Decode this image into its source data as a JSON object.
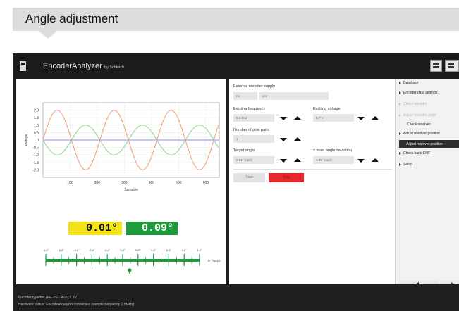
{
  "heading": "Angle adjustment",
  "app": {
    "title": "EncoderAnalyzer",
    "subtitle": "by Schleich"
  },
  "chart_data": {
    "type": "line",
    "xlabel": "Samples",
    "ylabel": "Voltage",
    "xlim": [
      0,
      650
    ],
    "ylim": [
      -2.5,
      2.5
    ],
    "x_ticks": [
      "100",
      "200",
      "300",
      "400",
      "500",
      "600"
    ],
    "y_ticks": [
      "2.0",
      "1.5",
      "1.0",
      "0.5",
      "0",
      "-0.5",
      "-1.0",
      "-1.5",
      "-2.0"
    ],
    "series": [
      {
        "color": "#f2a47a",
        "amplitude": 2.0,
        "period": 210,
        "phase_deg": 0
      },
      {
        "color": "#9ed49a",
        "amplitude": 1.0,
        "period": 210,
        "phase_deg": 180
      },
      {
        "color": "#8c8cff",
        "amplitude": 0.0,
        "period": 210,
        "phase_deg": 0
      }
    ]
  },
  "values": {
    "angle": "0.01°",
    "deviation": "0.09°",
    "yellow": "#f2e21a",
    "green": "#1f9a3c"
  },
  "scale": {
    "ticks": [
      "-1,0°",
      "-0,8°",
      "-0,6°",
      "-0,4°",
      "-0,2°",
      "0,0°",
      "0,2°",
      "0,4°",
      "0,6°",
      "0,8°",
      "1,0°"
    ],
    "unit": "in °mech",
    "indicator": 0.09
  },
  "form": {
    "supply_label": "External encoder supply",
    "supply_value1": "no",
    "supply_value2": "yes",
    "freq_label": "Exciting frequency",
    "freq_value": "5.0",
    "freq_unit": "kHz",
    "volt_label": "Exciting voltage",
    "volt_value": "5.7 V",
    "pole_label": "Number of pole pairs",
    "pole_value": "1",
    "target_label": "Target angle",
    "target_value": "0.01",
    "target_unit": "°mech",
    "dev_label": "± max. angle deviation",
    "dev_value": "1.00",
    "dev_unit": "°mech",
    "start_label": "Start",
    "stop_label": "Stop"
  },
  "sidebar": {
    "items": [
      {
        "label": "Database",
        "state": "normal"
      },
      {
        "label": "Encoder data settings",
        "state": "normal"
      },
      {
        "label": "Check encoder",
        "state": "disabled"
      },
      {
        "label": "Adjust encoder angle",
        "state": "disabled"
      },
      {
        "label": "Check resolver",
        "state": "sub"
      },
      {
        "label": "Adjust resolver position",
        "state": "normal"
      },
      {
        "label": "Adjust resolver position",
        "state": "selected"
      },
      {
        "label": "Check back-EMF",
        "state": "normal"
      },
      {
        "label": "Setup",
        "state": "normal"
      }
    ]
  },
  "status": {
    "line1": "Encoder type/fm: [RE-25-1-A05] 5.3V",
    "line2": "Hardware status: EncoderAnalyzer connected (sample frequency 2.5MHz)"
  }
}
